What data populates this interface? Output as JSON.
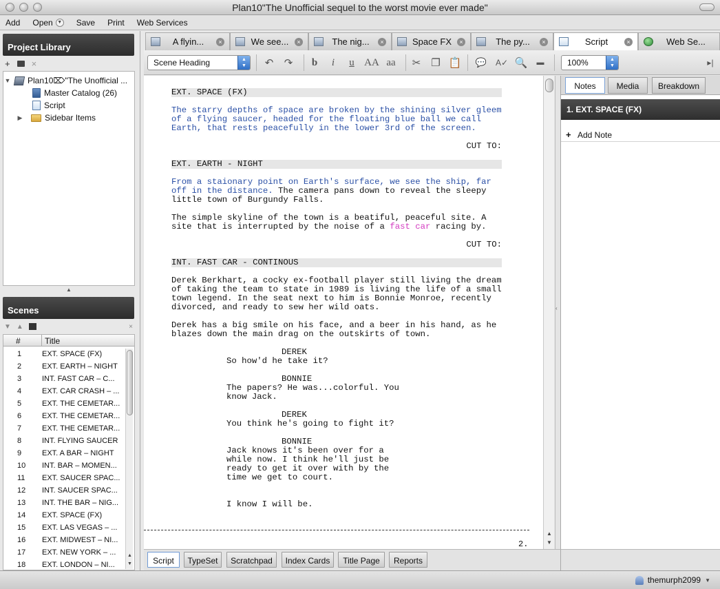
{
  "window": {
    "title": "Plan10\"The Unofficial sequel to the worst movie ever made\""
  },
  "menu": {
    "add": "Add",
    "open": "Open",
    "save": "Save",
    "print": "Print",
    "web_services": "Web Services"
  },
  "library": {
    "title": "Project Library",
    "items": [
      {
        "label": "Plan10⌦\"The Unofficial ..."
      },
      {
        "label": "Master Catalog (26)"
      },
      {
        "label": "Script"
      },
      {
        "label": "Sidebar Items"
      }
    ]
  },
  "scenes": {
    "title": "Scenes",
    "columns": [
      "#",
      "Title"
    ],
    "rows": [
      {
        "num": "1",
        "title": "EXT. SPACE (FX)"
      },
      {
        "num": "2",
        "title": "EXT. EARTH – NIGHT"
      },
      {
        "num": "3",
        "title": "INT. FAST CAR – C..."
      },
      {
        "num": "4",
        "title": "EXT. CAR CRASH – ..."
      },
      {
        "num": "5",
        "title": "EXT. THE CEMETAR..."
      },
      {
        "num": "6",
        "title": "EXT. THE CEMETAR..."
      },
      {
        "num": "7",
        "title": "EXT. THE CEMETAR..."
      },
      {
        "num": "8",
        "title": "INT. FLYING SAUCER"
      },
      {
        "num": "9",
        "title": "EXT. A BAR – NIGHT"
      },
      {
        "num": "10",
        "title": "INT. BAR – MOMEN..."
      },
      {
        "num": "11",
        "title": "EXT. SAUCER SPAC..."
      },
      {
        "num": "12",
        "title": "INT. SAUCER SPAC..."
      },
      {
        "num": "13",
        "title": "INT. THE BAR – NIG..."
      },
      {
        "num": "14",
        "title": "EXT. SPACE (FX)"
      },
      {
        "num": "15",
        "title": "EXT. LAS VEGAS – ..."
      },
      {
        "num": "16",
        "title": "EXT. MIDWEST – NI..."
      },
      {
        "num": "17",
        "title": "EXT. NEW YORK – ..."
      },
      {
        "num": "18",
        "title": "EXT. LONDON – NI..."
      }
    ]
  },
  "tabs": [
    {
      "label": "A flyin...",
      "icon": "catalog-icon"
    },
    {
      "label": "We see...",
      "icon": "catalog-icon"
    },
    {
      "label": "The nig...",
      "icon": "catalog-icon"
    },
    {
      "label": "Space FX",
      "icon": "catalog-icon"
    },
    {
      "label": "The py...",
      "icon": "catalog-icon"
    },
    {
      "label": "Script",
      "icon": "script-icon"
    },
    {
      "label": "Web Se...",
      "icon": "globe-icon"
    }
  ],
  "toolbar": {
    "element_style": "Scene Heading",
    "bold": "b",
    "italic": "i",
    "underline": "u",
    "upper": "AA",
    "lower": "aa",
    "zoom": "100%"
  },
  "script": {
    "s1_heading": "EXT. SPACE (FX)",
    "s1_action": "The starry depths of space are broken by the shining silver gleem of a flying saucer, headed for the floating blue ball we call Earth, that rests peacefully in the lower 3rd of the screen.",
    "transition": "CUT TO:",
    "s2_heading": "EXT. EARTH - NIGHT",
    "s2_action_blue": "From a staionary point on Earth's surface, we see the ship, far off in the distance.",
    "s2_action_rest": "  The camera pans down to reveal the sleepy little town of Burgundy Falls.",
    "s2_action2_a": "The simple skyline of the town is a beatiful, peaceful site.  A site that is interrupted by the noise of a ",
    "s2_action2_pink": "fast car",
    "s2_action2_b": " racing by.",
    "s3_heading": "INT. FAST CAR - CONTINOUS",
    "s3_action1": "Derek Berkhart, a cocky ex-football player still living the dream of taking the team to state in 1989 is living the life of a small town legend.  In the seat next to him is Bonnie Monroe, recently divorced, and ready to sew her wild oats.",
    "s3_action2": "Derek has a big smile on his face, and a beer in his hand, as he blazes down the main drag on the outskirts of town.",
    "char_derek": "DEREK",
    "char_bonnie": "BONNIE",
    "dia1": "So how'd he take it?",
    "dia2": "The papers?  He was...colorful. You know Jack.",
    "dia3": "You think he's going to fight it?",
    "dia4": "Jack knows it's been over for a while now.  I think he'll just be ready to get it over with by the time we get to court.",
    "dia5": "I know I will be.",
    "page_number": "2."
  },
  "notes": {
    "tabs": [
      "Notes",
      "Media",
      "Breakdown"
    ],
    "scene_title": "1. EXT. SPACE (FX)",
    "add_note": "Add Note"
  },
  "bottom_tabs": [
    "Script",
    "TypeSet",
    "Scratchpad",
    "Index Cards",
    "Title Page",
    "Reports"
  ],
  "status": {
    "user": "themurph2099"
  }
}
